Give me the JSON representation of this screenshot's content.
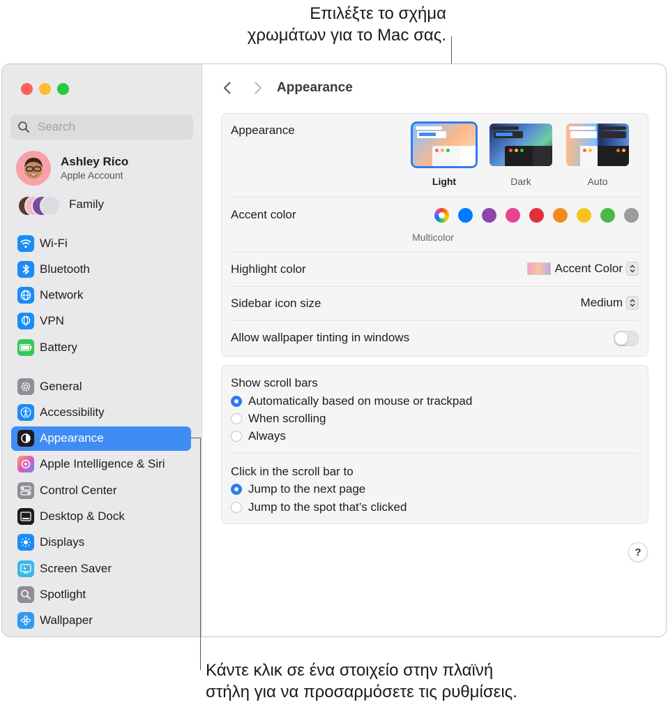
{
  "callouts": {
    "top_line1": "Επιλέξτε το σχήμα",
    "top_line2": "χρωμάτων για το Mac σας.",
    "bottom_line1": "Κάντε κλικ σε ένα στοιχείο στην πλαϊνή",
    "bottom_line2": "στήλη για να προσαρμόσετε τις ρυθμίσεις."
  },
  "sidebar": {
    "search_placeholder": "Search",
    "account": {
      "name": "Ashley Rico",
      "subtitle": "Apple Account"
    },
    "family_label": "Family",
    "items": [
      {
        "label": "Wi-Fi",
        "icon": "wifi-icon",
        "color": "#1a8cf5"
      },
      {
        "label": "Bluetooth",
        "icon": "bluetooth-icon",
        "color": "#1a8cf5"
      },
      {
        "label": "Network",
        "icon": "globe-icon",
        "color": "#1a8cf5"
      },
      {
        "label": "VPN",
        "icon": "vpn-globe-icon",
        "color": "#1a8cf5"
      },
      {
        "label": "Battery",
        "icon": "battery-icon",
        "color": "#34c759"
      },
      {
        "label": "General",
        "icon": "gear-icon",
        "color": "#8e8e93"
      },
      {
        "label": "Accessibility",
        "icon": "accessibility-icon",
        "color": "#1a8cf5"
      },
      {
        "label": "Appearance",
        "icon": "appearance-icon",
        "color": "#1c1c1e",
        "active": true
      },
      {
        "label": "Apple Intelligence & Siri",
        "icon": "siri-icon",
        "color": "#c86cf0"
      },
      {
        "label": "Control Center",
        "icon": "control-center-icon",
        "color": "#8e8e93"
      },
      {
        "label": "Desktop & Dock",
        "icon": "dock-icon",
        "color": "#1c1c1e"
      },
      {
        "label": "Displays",
        "icon": "sun-icon",
        "color": "#1a8cf5"
      },
      {
        "label": "Screen Saver",
        "icon": "screen-saver-icon",
        "color": "#3cb6e8"
      },
      {
        "label": "Spotlight",
        "icon": "spotlight-icon",
        "color": "#8e8e93"
      },
      {
        "label": "Wallpaper",
        "icon": "wallpaper-icon",
        "color": "#2f9bf0"
      }
    ]
  },
  "main": {
    "title": "Appearance",
    "appearance": {
      "label": "Appearance",
      "options": [
        "Light",
        "Dark",
        "Auto"
      ],
      "selected": "Light"
    },
    "accent": {
      "label": "Accent color",
      "selected_name": "Multicolor",
      "colors": [
        "#007aff",
        "#8e44ad",
        "#e84393",
        "#e0303a",
        "#f48a1e",
        "#f6c31d",
        "#4cb846",
        "#9b9b9b"
      ]
    },
    "highlight": {
      "label": "Highlight color",
      "value": "Accent Color"
    },
    "icon_size": {
      "label": "Sidebar icon size",
      "value": "Medium"
    },
    "tinting": {
      "label": "Allow wallpaper tinting in windows",
      "on": false
    },
    "scroll_bars": {
      "title": "Show scroll bars",
      "options": [
        "Automatically based on mouse or trackpad",
        "When scrolling",
        "Always"
      ],
      "selected": 0
    },
    "click_scroll": {
      "title": "Click in the scroll bar to",
      "options": [
        "Jump to the next page",
        "Jump to the spot that’s clicked"
      ],
      "selected": 0
    },
    "help_label": "?"
  }
}
